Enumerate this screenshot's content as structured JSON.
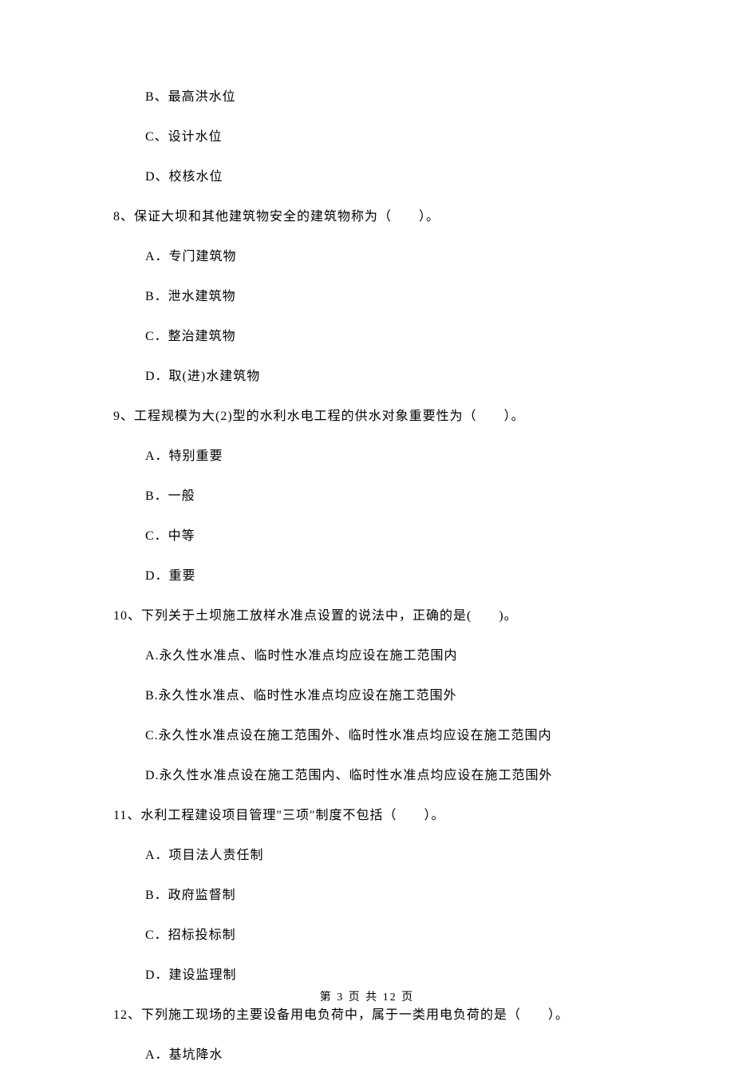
{
  "q7": {
    "options": {
      "B": "B、最高洪水位",
      "C": "C、设计水位",
      "D": "D、校核水位"
    }
  },
  "q8": {
    "stem": "8、保证大坝和其他建筑物安全的建筑物称为（　　）。",
    "options": {
      "A": "A．专门建筑物",
      "B": "B．泄水建筑物",
      "C": "C．整治建筑物",
      "D": "D．取(进)水建筑物"
    }
  },
  "q9": {
    "stem": "9、工程规模为大(2)型的水利水电工程的供水对象重要性为（　　）。",
    "options": {
      "A": "A．特别重要",
      "B": "B．一般",
      "C": "C．中等",
      "D": "D．重要"
    }
  },
  "q10": {
    "stem": "10、下列关于土坝施工放样水准点设置的说法中，正确的是(　　)。",
    "options": {
      "A": "A.永久性水准点、临时性水准点均应设在施工范围内",
      "B": "B.永久性水准点、临时性水准点均应设在施工范围外",
      "C": "C.永久性水准点设在施工范围外、临时性水准点均应设在施工范围内",
      "D": "D.永久性水准点设在施工范围内、临时性水准点均应设在施工范围外"
    }
  },
  "q11": {
    "stem": "11、水利工程建设项目管理\"三项\"制度不包括（　　）。",
    "options": {
      "A": "A．项目法人责任制",
      "B": "B．政府监督制",
      "C": "C．招标投标制",
      "D": "D．建设监理制"
    }
  },
  "q12": {
    "stem": "12、下列施工现场的主要设备用电负荷中，属于一类用电负荷的是（　　）。",
    "options": {
      "A": "A．基坑降水"
    }
  },
  "footer": "第 3 页 共 12 页"
}
